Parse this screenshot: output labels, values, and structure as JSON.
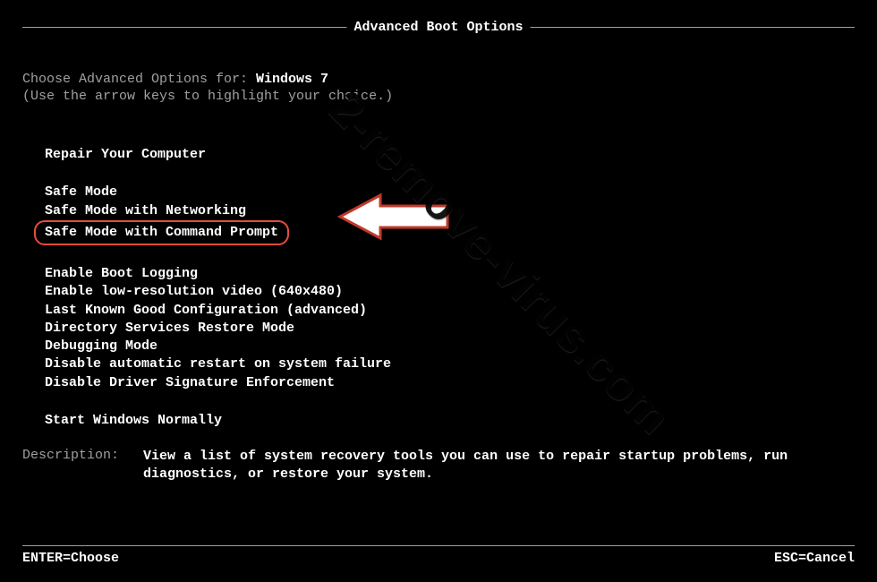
{
  "title": "Advanced Boot Options",
  "prompt": {
    "label": "Choose Advanced Options for: ",
    "os": "Windows 7",
    "hint": "(Use the arrow keys to highlight your choice.)"
  },
  "menu": {
    "repair": "Repair Your Computer",
    "items1": {
      "safe_mode": "Safe Mode",
      "safe_mode_net": "Safe Mode with Networking",
      "safe_mode_cmd": "Safe Mode with Command Prompt"
    },
    "items2": {
      "boot_logging": "Enable Boot Logging",
      "low_res": "Enable low-resolution video (640x480)",
      "last_known": "Last Known Good Configuration (advanced)",
      "ds_restore": "Directory Services Restore Mode",
      "debugging": "Debugging Mode",
      "disable_restart": "Disable automatic restart on system failure",
      "disable_driver_sig": "Disable Driver Signature Enforcement"
    },
    "start_normally": "Start Windows Normally"
  },
  "description": {
    "label": "Description:",
    "text": "View a list of system recovery tools you can use to repair startup problems, run diagnostics, or restore your system."
  },
  "footer": {
    "enter": "ENTER=Choose",
    "esc": "ESC=Cancel"
  },
  "watermark": "2-remove-virus.com"
}
